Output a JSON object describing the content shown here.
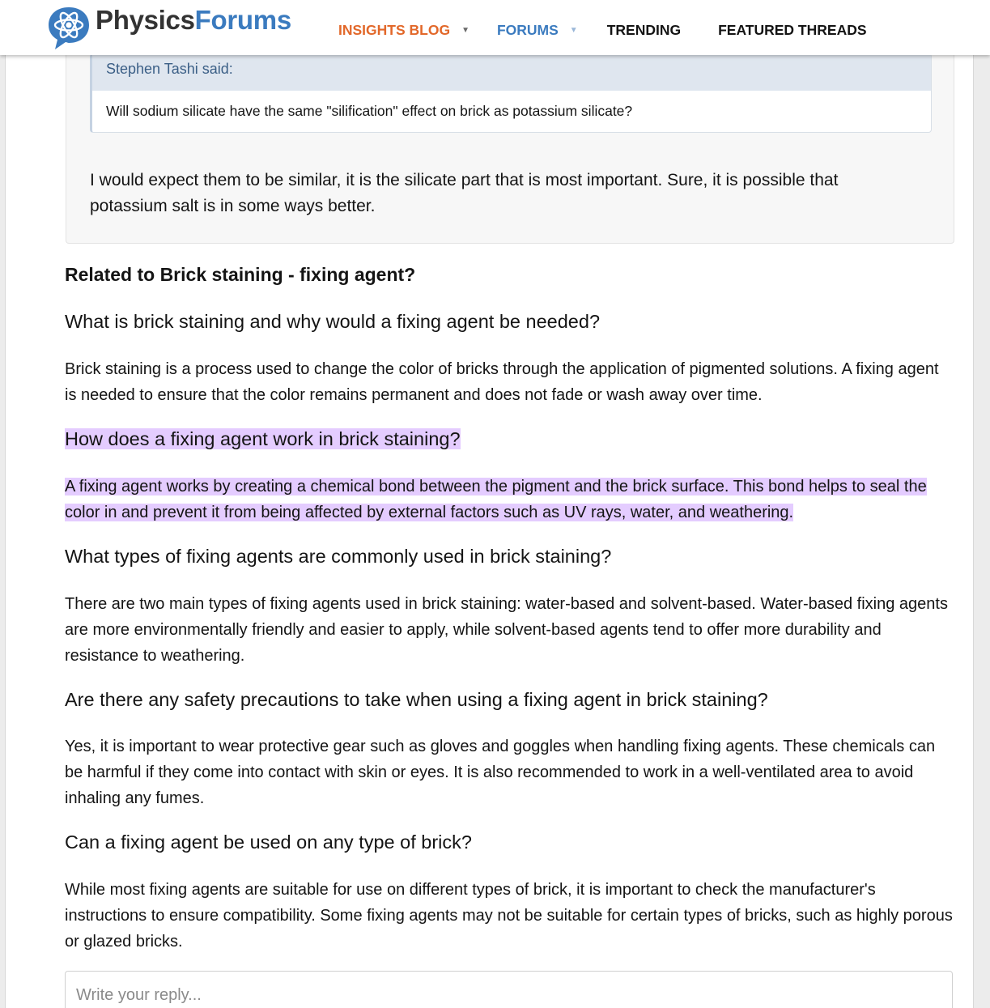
{
  "header": {
    "logo_part1": "Physics",
    "logo_part2": "Forums",
    "logo_icon": "atom-speech-bubble-icon",
    "nav": {
      "insights": "INSIGHTS BLOG",
      "forums": "FORUMS",
      "trending": "TRENDING",
      "featured": "FEATURED THREADS"
    },
    "colors": {
      "insights": "#e2682a",
      "forums": "#3b7bbf",
      "brand_blue": "#3b7bbf"
    }
  },
  "post": {
    "quote_author": "Stephen Tashi said:",
    "quote_text": "Will sodium silicate have the same \"silification\" effect on brick as potassium silicate?",
    "reply_text": "I would expect them to be similar, it is the silicate part that is most important. Sure, it is possible that potassium salt is in some ways better."
  },
  "related": {
    "title": "Related to Brick staining - fixing agent?",
    "items": [
      {
        "question": "What is brick staining and why would a fixing agent be needed?",
        "answer": "Brick staining is a process used to change the color of bricks through the application of pigmented solutions. A fixing agent is needed to ensure that the color remains permanent and does not fade or wash away over time."
      },
      {
        "question": "How does a fixing agent work in brick staining?",
        "answer": "A fixing agent works by creating a chemical bond between the pigment and the brick surface. This bond helps to seal the color in and prevent it from being affected by external factors such as UV rays, water, and weathering."
      },
      {
        "question": "What types of fixing agents are commonly used in brick staining?",
        "answer": "There are two main types of fixing agents used in brick staining: water-based and solvent-based. Water-based fixing agents are more environmentally friendly and easier to apply, while solvent-based agents tend to offer more durability and resistance to weathering."
      },
      {
        "question": "Are there any safety precautions to take when using a fixing agent in brick staining?",
        "answer": "Yes, it is important to wear protective gear such as gloves and goggles when handling fixing agents. These chemicals can be harmful if they come into contact with skin or eyes. It is also recommended to work in a well-ventilated area to avoid inhaling any fumes."
      },
      {
        "question": "Can a fixing agent be used on any type of brick?",
        "answer": "While most fixing agents are suitable for use on different types of brick, it is important to check the manufacturer's instructions to ensure compatibility. Some fixing agents may not be suitable for certain types of bricks, such as highly porous or glazed bricks."
      }
    ],
    "highlight_color": "#e4ccff"
  },
  "reply": {
    "placeholder": "Write your reply..."
  }
}
